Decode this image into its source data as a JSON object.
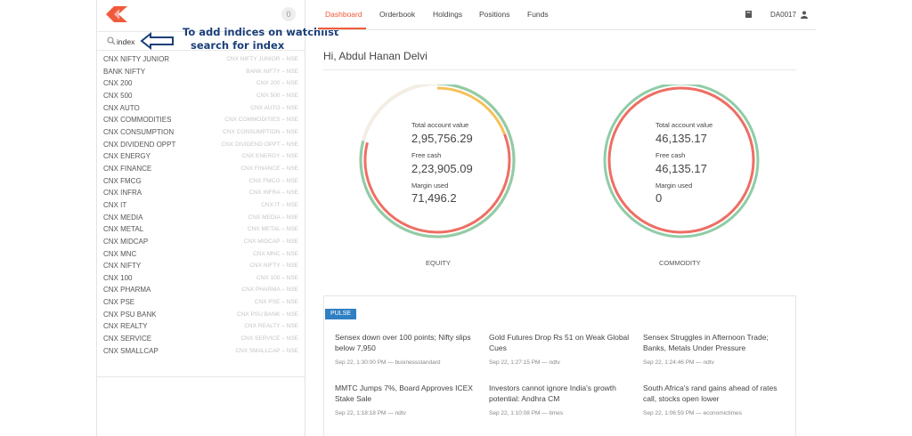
{
  "sidebar": {
    "watchlist_count": "0",
    "search": {
      "value": "index",
      "placeholder": ""
    },
    "results": [
      {
        "name": "CNX NIFTY JUNIOR",
        "detail": "CNX NIFTY JUNIOR – NSE"
      },
      {
        "name": "BANK NIFTY",
        "detail": "BANK NIFTY – NSE"
      },
      {
        "name": "CNX 200",
        "detail": "CNX 200 – NSE"
      },
      {
        "name": "CNX 500",
        "detail": "CNX 500 – NSE"
      },
      {
        "name": "CNX AUTO",
        "detail": "CNX AUTO – NSE"
      },
      {
        "name": "CNX COMMODITIES",
        "detail": "CNX COMMODITIES – NSE"
      },
      {
        "name": "CNX CONSUMPTION",
        "detail": "CNX CONSUMPTION – NSE"
      },
      {
        "name": "CNX DIVIDEND OPPT",
        "detail": "CNX DIVIDEND OPPT – NSE"
      },
      {
        "name": "CNX ENERGY",
        "detail": "CNX ENERGY – NSE"
      },
      {
        "name": "CNX FINANCE",
        "detail": "CNX FINANCE – NSE"
      },
      {
        "name": "CNX FMCG",
        "detail": "CNX FMCG – NSE"
      },
      {
        "name": "CNX INFRA",
        "detail": "CNX INFRA – NSE"
      },
      {
        "name": "CNX IT",
        "detail": "CNX IT – NSE"
      },
      {
        "name": "CNX MEDIA",
        "detail": "CNX MEDIA – NSE"
      },
      {
        "name": "CNX METAL",
        "detail": "CNX METAL – NSE"
      },
      {
        "name": "CNX MIDCAP",
        "detail": "CNX MIDCAP – NSE"
      },
      {
        "name": "CNX MNC",
        "detail": "CNX MNC – NSE"
      },
      {
        "name": "CNX NIFTY",
        "detail": "CNX NIFTY – NSE"
      },
      {
        "name": "CNX 100",
        "detail": "CNX 100 – NSE"
      },
      {
        "name": "CNX PHARMA",
        "detail": "CNX PHARMA – NSE"
      },
      {
        "name": "CNX PSE",
        "detail": "CNX PSE – NSE"
      },
      {
        "name": "CNX PSU BANK",
        "detail": "CNX PSU BANK – NSE"
      },
      {
        "name": "CNX REALTY",
        "detail": "CNX REALTY – NSE"
      },
      {
        "name": "CNX SERVICE",
        "detail": "CNX SERVICE – NSE"
      },
      {
        "name": "CNX SMALLCAP",
        "detail": "CNX SMALLCAP – NSE"
      }
    ]
  },
  "annotation": {
    "line1": "To add indices on watchlist",
    "line2": "search for index"
  },
  "nav": {
    "tabs": [
      "Dashboard",
      "Orderbook",
      "Holdings",
      "Positions",
      "Funds"
    ],
    "active_tab": "Dashboard",
    "user_id": "DA0017"
  },
  "greeting": "Hi, Abdul Hanan Delvi",
  "accounts": [
    {
      "caption": "EQUITY",
      "total_label": "Total account value",
      "total_value": "2,95,756.29",
      "free_label": "Free cash",
      "free_value": "2,23,905.09",
      "margin_label": "Margin used",
      "margin_value": "71,496.2"
    },
    {
      "caption": "COMMODITY",
      "total_label": "Total account value",
      "total_value": "46,135.17",
      "free_label": "Free cash",
      "free_value": "46,135.17",
      "margin_label": "Margin used",
      "margin_value": "0"
    }
  ],
  "pulse": {
    "label": "PULSE",
    "news": [
      {
        "title": "Sensex down over 100 points; Nifty slips below 7,950",
        "meta": "Sep 22, 1:30:00 PM — businessstandard"
      },
      {
        "title": "Gold Futures Drop Rs 51 on Weak Global Cues",
        "meta": "Sep 22, 1:27:15 PM — ndtv"
      },
      {
        "title": "Sensex Struggles in Afternoon Trade; Banks, Metals Under Pressure",
        "meta": "Sep 22, 1:24:46 PM — ndtv"
      },
      {
        "title": "MMTC Jumps 7%, Board Approves ICEX Stake Sale",
        "meta": "Sep 22, 1:18:18 PM — ndtv"
      },
      {
        "title": "Investors cannot ignore India's growth potential: Andhra CM",
        "meta": "Sep 22, 1:10:08 PM — times"
      },
      {
        "title": "South Africa's rand gains ahead of rates call, stocks open lower",
        "meta": "Sep 22, 1:06:59 PM — economictimes"
      }
    ]
  },
  "colors": {
    "accent": "#f05a3a",
    "ring_green": "#8fcca6",
    "ring_red": "#ee6e64",
    "ring_yellow": "#f5c15a",
    "ring_faint": "#f3ede4",
    "annotation_blue": "#1b3f7a",
    "pulse_blue": "#2f80c2"
  }
}
